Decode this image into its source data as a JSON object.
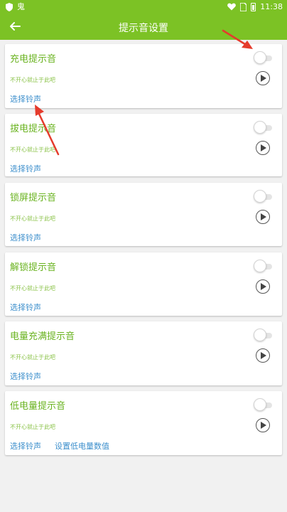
{
  "status_bar": {
    "left_icons": [
      "shield-icon",
      "ghost-icon"
    ],
    "right_icons": [
      "heart-icon",
      "sim-icon",
      "battery-icon"
    ],
    "time": "11:38"
  },
  "app_bar": {
    "title": "提示音设置",
    "back_icon": "arrow-left-icon"
  },
  "colors": {
    "primary": "#7cc225",
    "title_text": "#6ab320",
    "link": "#3d8fcc",
    "annotation_arrow": "#e53b2c"
  },
  "cards": [
    {
      "name": "充电提示音",
      "desc": "不开心就止于此吧",
      "links": [
        "选择铃声"
      ]
    },
    {
      "name": "拔电提示音",
      "desc": "不开心就止于此吧",
      "links": [
        "选择铃声"
      ]
    },
    {
      "name": "锁屏提示音",
      "desc": "不开心就止于此吧",
      "links": [
        "选择铃声"
      ]
    },
    {
      "name": "解锁提示音",
      "desc": "不开心就止于此吧",
      "links": [
        "选择铃声"
      ]
    },
    {
      "name": "电量充满提示音",
      "desc": "不开心就止于此吧",
      "links": [
        "选择铃声"
      ]
    },
    {
      "name": "低电量提示音",
      "desc": "不开心就止于此吧",
      "links": [
        "选择铃声",
        "设置低电量数值"
      ]
    }
  ]
}
